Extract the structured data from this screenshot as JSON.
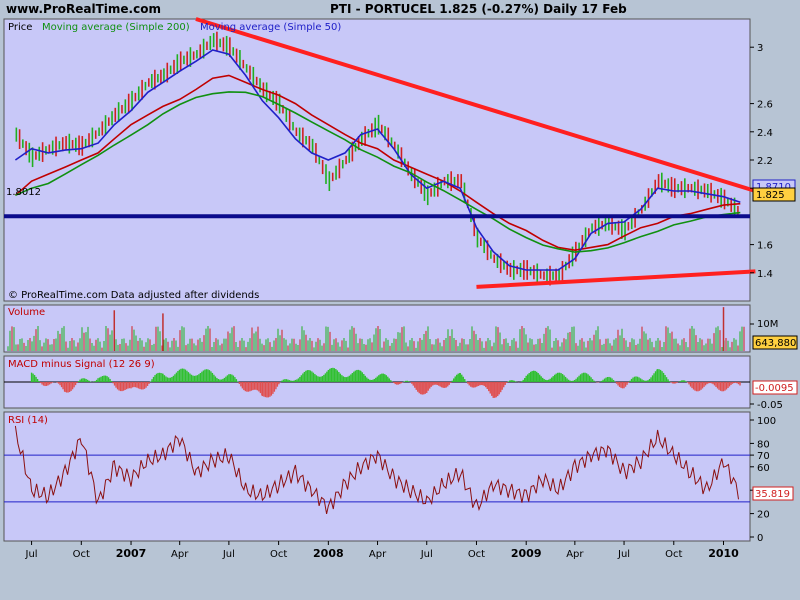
{
  "header": {
    "site": "www.ProRealTime.com",
    "title": "PTI - PORTUCEL    1.825 (-0.27%)    Daily  17 Feb"
  },
  "colors": {
    "panel_bg": "#c8c8f8",
    "outer_bg": "#b7c4d4",
    "trend": "#ff2020",
    "support": "#0b0b8c",
    "ma200": "#c00000",
    "ma50": "#2020c8",
    "ma_green": "#109010",
    "up": "#20b020",
    "down": "#d02020"
  },
  "chart_data": [
    {
      "type": "line",
      "panel": "price",
      "legend": [
        "Price",
        "Moving average (Simple 200)",
        "Moving average (Simple 50)"
      ],
      "ylim": [
        1.2,
        3.2
      ],
      "yticks": [
        "3",
        "2.6",
        "2.4",
        "2.2",
        "2",
        "1.6",
        "1.4"
      ],
      "yticks_values": [
        3,
        2.6,
        2.4,
        2.2,
        2,
        1.6,
        1.4
      ],
      "x": [
        "2006-06",
        "2006-07",
        "2006-08",
        "2006-09",
        "2006-10",
        "2006-11",
        "2006-12",
        "2007-01",
        "2007-02",
        "2007-03",
        "2007-04",
        "2007-05",
        "2007-06",
        "2007-07",
        "2007-08",
        "2007-09",
        "2007-10",
        "2007-11",
        "2007-12",
        "2008-01",
        "2008-02",
        "2008-03",
        "2008-04",
        "2008-05",
        "2008-06",
        "2008-07",
        "2008-08",
        "2008-09",
        "2008-10",
        "2008-11",
        "2008-12",
        "2009-01",
        "2009-02",
        "2009-03",
        "2009-04",
        "2009-05",
        "2009-06",
        "2009-07",
        "2009-08",
        "2009-09",
        "2009-10",
        "2009-11",
        "2009-12",
        "2010-01",
        "2010-02"
      ],
      "series": [
        {
          "name": "Price",
          "values": [
            2.38,
            2.22,
            2.28,
            2.32,
            2.3,
            2.4,
            2.52,
            2.62,
            2.75,
            2.8,
            2.9,
            2.95,
            3.05,
            3.0,
            2.85,
            2.7,
            2.6,
            2.4,
            2.3,
            2.05,
            2.2,
            2.35,
            2.45,
            2.3,
            2.1,
            1.95,
            2.05,
            2.05,
            1.65,
            1.5,
            1.42,
            1.42,
            1.38,
            1.38,
            1.55,
            1.72,
            1.75,
            1.7,
            1.85,
            2.05,
            2.0,
            2.0,
            1.98,
            1.92,
            1.825
          ]
        },
        {
          "name": "Moving average (Simple 50)",
          "values": [
            2.2,
            2.28,
            2.25,
            2.27,
            2.28,
            2.32,
            2.45,
            2.55,
            2.68,
            2.75,
            2.83,
            2.9,
            2.98,
            2.95,
            2.8,
            2.62,
            2.5,
            2.35,
            2.25,
            2.2,
            2.25,
            2.38,
            2.42,
            2.28,
            2.1,
            2.0,
            2.05,
            2.0,
            1.72,
            1.55,
            1.45,
            1.42,
            1.42,
            1.42,
            1.5,
            1.68,
            1.75,
            1.76,
            1.85,
            2.0,
            1.98,
            1.98,
            1.96,
            1.94,
            1.9
          ]
        },
        {
          "name": "Moving average (Simple 200)",
          "values": [
            1.95,
            2.05,
            2.1,
            2.15,
            2.2,
            2.25,
            2.35,
            2.45,
            2.52,
            2.58,
            2.63,
            2.7,
            2.78,
            2.8,
            2.75,
            2.7,
            2.66,
            2.6,
            2.52,
            2.45,
            2.38,
            2.32,
            2.28,
            2.2,
            2.15,
            2.1,
            2.05,
            1.98,
            1.9,
            1.82,
            1.75,
            1.7,
            1.63,
            1.58,
            1.56,
            1.58,
            1.6,
            1.66,
            1.72,
            1.75,
            1.8,
            1.82,
            1.85,
            1.88,
            1.89
          ]
        }
      ],
      "lines": [
        {
          "name": "downtrend",
          "from": [
            "2007-05",
            3.2
          ],
          "to": [
            "2010-03",
            1.98
          ]
        },
        {
          "name": "uptrend",
          "from": [
            "2008-10",
            1.3
          ],
          "to": [
            "2010-03",
            1.41
          ]
        },
        {
          "name": "support",
          "value": 1.8012
        }
      ],
      "labels": {
        "support_value": "1.8012",
        "ma_value": "1.8710",
        "last_price": "1.825"
      },
      "annotation": "© ProRealTime.com Data adjusted after dividends"
    },
    {
      "type": "bar",
      "panel": "volume",
      "legend": [
        "Volume"
      ],
      "yticks": [
        "10M"
      ],
      "last_value": "643,880",
      "spikes": [
        {
          "x": "2006-12",
          "value": 13000000
        },
        {
          "x": "2007-03",
          "value": 12000000
        },
        {
          "x": "2010-01",
          "value": 14000000
        }
      ]
    },
    {
      "type": "bar",
      "panel": "macd",
      "legend": [
        "MACD minus Signal (12 26 9)"
      ],
      "yticks": [
        "-0.05"
      ],
      "last_value": "-0.0095",
      "x": [
        "2006-07",
        "2006-09",
        "2006-11",
        "2007-01",
        "2007-03",
        "2007-05",
        "2007-07",
        "2007-09",
        "2007-11",
        "2008-01",
        "2008-03",
        "2008-05",
        "2008-07",
        "2008-09",
        "2008-11",
        "2009-01",
        "2009-03",
        "2009-05",
        "2009-07",
        "2009-09",
        "2009-11",
        "2010-01",
        "2010-02"
      ],
      "values": [
        0.01,
        -0.015,
        0.012,
        -0.02,
        0.015,
        0.02,
        0.01,
        -0.03,
        0.012,
        0.02,
        0.015,
        0.005,
        -0.02,
        0.01,
        -0.025,
        0.015,
        0.01,
        0.01,
        -0.005,
        0.018,
        -0.01,
        -0.01,
        -0.0095
      ]
    },
    {
      "type": "line",
      "panel": "rsi",
      "legend": [
        "RSI (14)"
      ],
      "ylim": [
        0,
        100
      ],
      "yticks": [
        "100",
        "80",
        "70",
        "60",
        "40",
        "20",
        "0"
      ],
      "yticks_values": [
        100,
        80,
        70,
        60,
        40,
        20,
        0
      ],
      "levels": [
        {
          "value": 70,
          "label": "70"
        },
        {
          "value": 30,
          "label": "30"
        }
      ],
      "last_value": "35.819",
      "x": [
        "2006-06",
        "2006-07",
        "2006-08",
        "2006-09",
        "2006-10",
        "2006-11",
        "2006-12",
        "2007-01",
        "2007-02",
        "2007-03",
        "2007-04",
        "2007-05",
        "2007-06",
        "2007-07",
        "2007-08",
        "2007-09",
        "2007-10",
        "2007-11",
        "2007-12",
        "2008-01",
        "2008-02",
        "2008-03",
        "2008-04",
        "2008-05",
        "2008-06",
        "2008-07",
        "2008-08",
        "2008-09",
        "2008-10",
        "2008-11",
        "2008-12",
        "2009-01",
        "2009-02",
        "2009-03",
        "2009-04",
        "2009-05",
        "2009-06",
        "2009-07",
        "2009-08",
        "2009-09",
        "2009-10",
        "2009-11",
        "2009-12",
        "2010-01",
        "2010-02"
      ],
      "values": [
        90,
        40,
        35,
        55,
        85,
        30,
        60,
        50,
        65,
        70,
        85,
        55,
        65,
        70,
        40,
        35,
        45,
        55,
        40,
        25,
        45,
        60,
        70,
        50,
        40,
        30,
        45,
        55,
        25,
        45,
        40,
        35,
        50,
        40,
        60,
        70,
        75,
        55,
        65,
        85,
        70,
        55,
        40,
        65,
        36
      ]
    }
  ],
  "xaxis": {
    "labels": [
      {
        "text": "Jul",
        "date": "2006-07",
        "bold": false
      },
      {
        "text": "Oct",
        "date": "2006-10",
        "bold": false
      },
      {
        "text": "2007",
        "date": "2007-01",
        "bold": true
      },
      {
        "text": "Apr",
        "date": "2007-04",
        "bold": false
      },
      {
        "text": "Jul",
        "date": "2007-07",
        "bold": false
      },
      {
        "text": "Oct",
        "date": "2007-10",
        "bold": false
      },
      {
        "text": "2008",
        "date": "2008-01",
        "bold": true
      },
      {
        "text": "Apr",
        "date": "2008-04",
        "bold": false
      },
      {
        "text": "Jul",
        "date": "2008-07",
        "bold": false
      },
      {
        "text": "Oct",
        "date": "2008-10",
        "bold": false
      },
      {
        "text": "2009",
        "date": "2009-01",
        "bold": true
      },
      {
        "text": "Apr",
        "date": "2009-04",
        "bold": false
      },
      {
        "text": "Jul",
        "date": "2009-07",
        "bold": false
      },
      {
        "text": "Oct",
        "date": "2009-10",
        "bold": false
      },
      {
        "text": "2010",
        "date": "2010-01",
        "bold": true
      }
    ]
  }
}
